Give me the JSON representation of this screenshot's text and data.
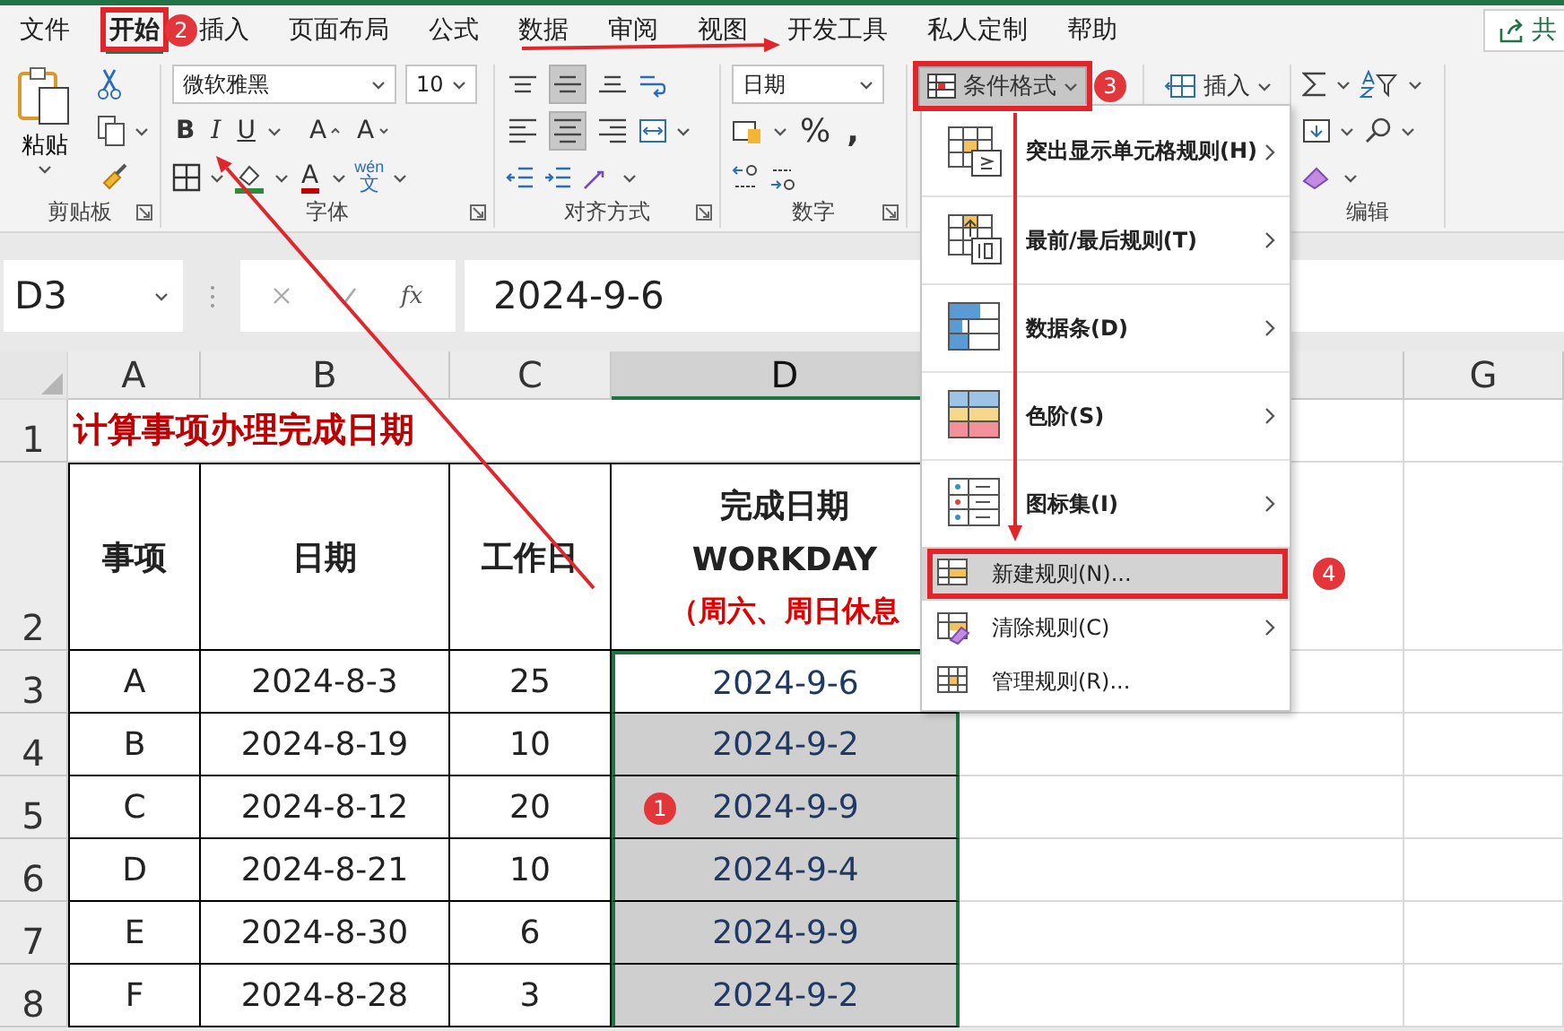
{
  "tabs": [
    {
      "label": "文件",
      "selected": false
    },
    {
      "label": "开始",
      "selected": true
    },
    {
      "label": "插入",
      "selected": false
    },
    {
      "label": "页面布局",
      "selected": false
    },
    {
      "label": "公式",
      "selected": false
    },
    {
      "label": "数据",
      "selected": false
    },
    {
      "label": "审阅",
      "selected": false
    },
    {
      "label": "视图",
      "selected": false
    },
    {
      "label": "开发工具",
      "selected": false
    },
    {
      "label": "私人定制",
      "selected": false
    },
    {
      "label": "帮助",
      "selected": false
    }
  ],
  "share_button": "共",
  "clipboard": {
    "paste": "粘贴",
    "group_label": "剪贴板"
  },
  "font": {
    "name": "微软雅黑",
    "size": "10",
    "style_buttons": [
      "B",
      "I",
      "U"
    ],
    "size_buttons": [
      "A",
      "A"
    ],
    "color_button": "A",
    "phonetic": {
      "pinyin": "wén",
      "char": "文"
    },
    "group_label": "字体"
  },
  "alignment": {
    "group_label": "对齐方式",
    "vertical": [
      {
        "selected": false
      },
      {
        "selected": true
      },
      {
        "selected": false
      }
    ],
    "horizontal": [
      {
        "selected": false
      },
      {
        "selected": true
      },
      {
        "selected": false
      }
    ]
  },
  "number": {
    "format": "日期",
    "percent": "%",
    "comma": ",",
    "group_label": "数字"
  },
  "styles": {
    "conditional_format": {
      "label": "条件格式",
      "pressed": true
    }
  },
  "cells": {
    "insert": "插入"
  },
  "editing": {
    "group_label": "编辑"
  },
  "name_box": "D3",
  "function_label": "fx",
  "formula": "2024-9-6",
  "columns": [
    {
      "label": "A",
      "selected": false
    },
    {
      "label": "B",
      "selected": false
    },
    {
      "label": "C",
      "selected": false
    },
    {
      "label": "D",
      "selected": true
    },
    {
      "label": "G",
      "selected": false
    }
  ],
  "row_numbers": [
    "1",
    "2",
    "3",
    "4",
    "5",
    "6",
    "7",
    "8"
  ],
  "sheet": {
    "title": "计算事项办理完成日期",
    "headers": [
      "事项",
      "日期",
      "工作日"
    ],
    "result_header": [
      "完成日期",
      "WORKDAY",
      "（周六、周日休息"
    ],
    "rows": [
      {
        "cells": [
          "A",
          "2024-8-3",
          "25",
          "2024-9-6"
        ],
        "selected": false
      },
      {
        "cells": [
          "B",
          "2024-8-19",
          "10",
          "2024-9-2"
        ],
        "selected": true
      },
      {
        "cells": [
          "C",
          "2024-8-12",
          "20",
          "2024-9-9"
        ],
        "selected": true
      },
      {
        "cells": [
          "D",
          "2024-8-21",
          "10",
          "2024-9-4"
        ],
        "selected": true
      },
      {
        "cells": [
          "E",
          "2024-8-30",
          "6",
          "2024-9-9"
        ],
        "selected": true
      },
      {
        "cells": [
          "F",
          "2024-8-28",
          "3",
          "2024-9-2"
        ],
        "selected": true
      }
    ]
  },
  "menu": {
    "items": [
      {
        "label": "突出显示单元格规则(H)",
        "kind": "large",
        "submenu": true,
        "highlighted": false
      },
      {
        "label": "最前/最后规则(T)",
        "kind": "large",
        "submenu": true,
        "highlighted": false
      },
      {
        "label": "数据条(D)",
        "kind": "large",
        "submenu": true,
        "highlighted": false
      },
      {
        "label": "色阶(S)",
        "kind": "large",
        "submenu": true,
        "highlighted": false
      },
      {
        "label": "图标集(I)",
        "kind": "large",
        "submenu": true,
        "highlighted": false
      },
      {
        "label": "新建规则(N)...",
        "kind": "small",
        "submenu": false,
        "highlighted": true
      },
      {
        "label": "清除规则(C)",
        "kind": "small",
        "submenu": true,
        "highlighted": false
      },
      {
        "label": "管理规则(R)...",
        "kind": "small",
        "submenu": false,
        "highlighted": false
      }
    ]
  },
  "step_badges": [
    "2",
    "3",
    "4",
    "1"
  ]
}
